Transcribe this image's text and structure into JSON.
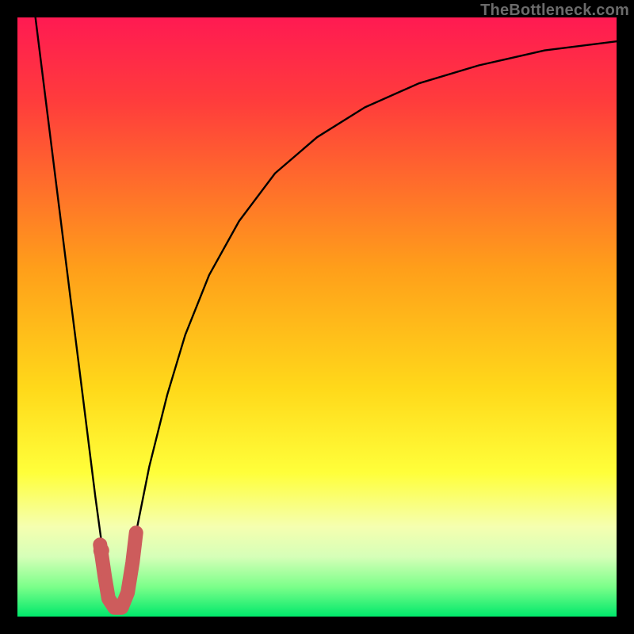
{
  "attribution": "TheBottleneck.com",
  "chart_data": {
    "type": "line",
    "title": "",
    "xlabel": "",
    "ylabel": "",
    "xlim": [
      0,
      100
    ],
    "ylim": [
      0,
      100
    ],
    "gradient_stops": [
      {
        "offset": 0.0,
        "color": "#ff1a52"
      },
      {
        "offset": 0.14,
        "color": "#ff3c3c"
      },
      {
        "offset": 0.42,
        "color": "#ff9f1a"
      },
      {
        "offset": 0.62,
        "color": "#ffd91a"
      },
      {
        "offset": 0.76,
        "color": "#ffff3a"
      },
      {
        "offset": 0.85,
        "color": "#f5ffb0"
      },
      {
        "offset": 0.9,
        "color": "#d6ffb8"
      },
      {
        "offset": 0.95,
        "color": "#7cff8a"
      },
      {
        "offset": 1.0,
        "color": "#00e86b"
      }
    ],
    "series": [
      {
        "name": "bottleneck-curve-left",
        "x": [
          3.0,
          5.0,
          7.0,
          9.0,
          11.0,
          13.0,
          14.5,
          15.5
        ],
        "values": [
          100.0,
          84.0,
          68.0,
          52.0,
          36.0,
          20.0,
          9.0,
          3.0
        ]
      },
      {
        "name": "bottleneck-curve-right",
        "x": [
          18.0,
          20.0,
          22.0,
          25.0,
          28.0,
          32.0,
          37.0,
          43.0,
          50.0,
          58.0,
          67.0,
          77.0,
          88.0,
          100.0
        ],
        "values": [
          5.0,
          15.0,
          25.0,
          37.0,
          47.0,
          57.0,
          66.0,
          74.0,
          80.0,
          85.0,
          89.0,
          92.0,
          94.5,
          96.0
        ]
      }
    ],
    "marker_path": {
      "name": "optimal-region-j",
      "color": "#cd5c5c",
      "points": [
        {
          "x": 13.8,
          "y": 12.0
        },
        {
          "x": 14.6,
          "y": 6.5
        },
        {
          "x": 15.2,
          "y": 3.0
        },
        {
          "x": 16.2,
          "y": 1.5
        },
        {
          "x": 17.4,
          "y": 1.5
        },
        {
          "x": 18.4,
          "y": 4.0
        },
        {
          "x": 19.2,
          "y": 9.0
        },
        {
          "x": 19.8,
          "y": 14.0
        }
      ],
      "dots": [
        {
          "x": 14.0,
          "y": 11.0
        },
        {
          "x": 14.7,
          "y": 6.0
        }
      ]
    }
  }
}
